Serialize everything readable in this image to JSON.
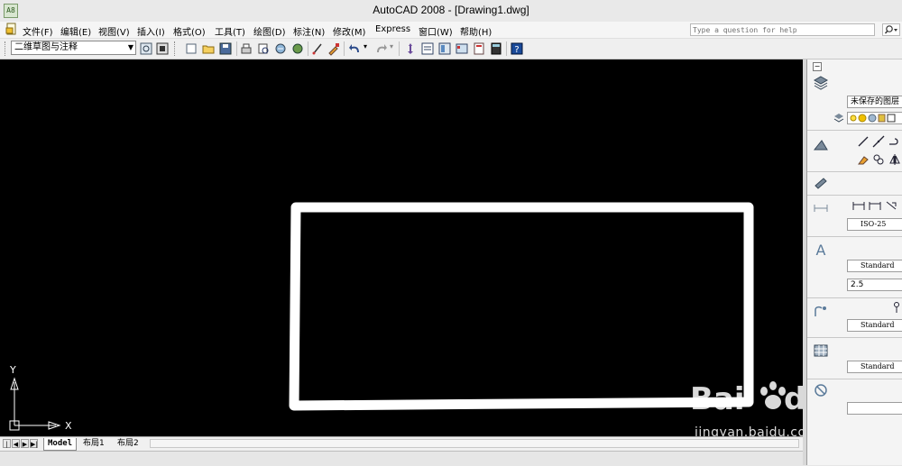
{
  "window": {
    "title": "AutoCAD 2008 - [Drawing1.dwg]",
    "app_icon_text": "A8"
  },
  "menu": {
    "items": [
      "文件(F)",
      "编辑(E)",
      "视图(V)",
      "插入(I)",
      "格式(O)",
      "工具(T)",
      "绘图(D)",
      "标注(N)",
      "修改(M)",
      "Express",
      "窗口(W)",
      "帮助(H)"
    ]
  },
  "help_search": {
    "placeholder": "Type a question for help"
  },
  "toolbar": {
    "workspace": "二维草图与注释"
  },
  "canvas": {
    "background": "#000000",
    "rect_color": "#ffffff",
    "ucs_x_label": "X",
    "ucs_y_label": "Y"
  },
  "layout_tabs": {
    "tabs": [
      "Model",
      "布局1",
      "布局2"
    ],
    "active": "Model"
  },
  "dashboard": {
    "layer_name": "未保存的图层",
    "dim_style": "ISO-25",
    "text_style": "Standard",
    "text_height": "2.5",
    "mleader_style": "Standard",
    "table_style": "Standard"
  },
  "watermark": {
    "logo_text": "Bai du 经验",
    "url": "jingyan.baidu.com"
  }
}
